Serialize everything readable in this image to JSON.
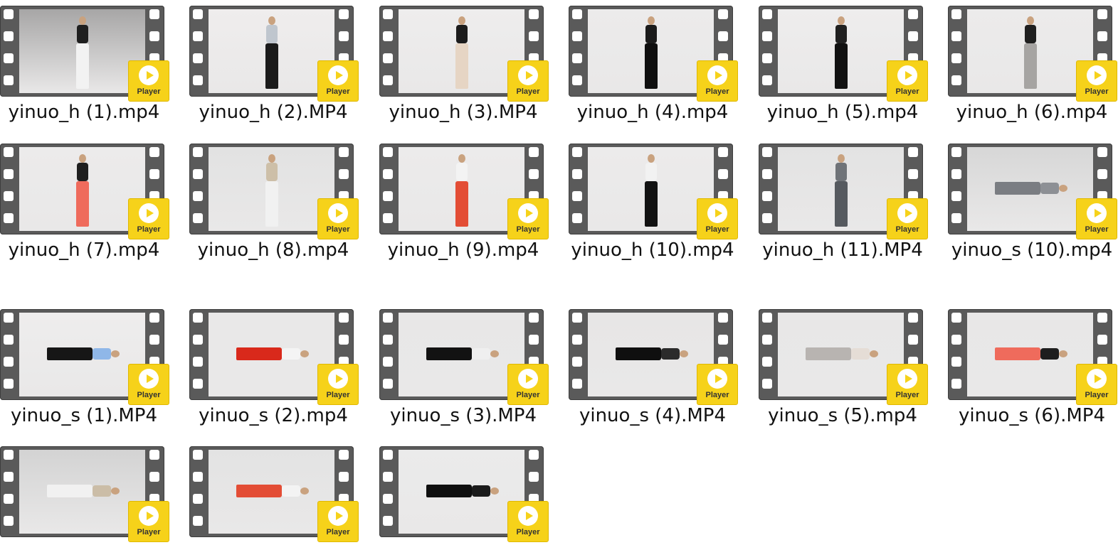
{
  "files": [
    {
      "name": "yinuo_h (1).mp4",
      "badge": "Player",
      "thumb": {
        "top": "#1f1f1f",
        "legs": "#f2f2f2",
        "bg": "#a7a6a6",
        "rot": false
      }
    },
    {
      "name": "yinuo_h (2).MP4",
      "badge": "Player",
      "thumb": {
        "top": "#bfc6ce",
        "legs": "#1b1b1b",
        "bg": "#efeded",
        "rot": false
      }
    },
    {
      "name": "yinuo_h (3).MP4",
      "badge": "Player",
      "thumb": {
        "top": "#1c1c1c",
        "legs": "#e6d5c4",
        "bg": "#eeeded",
        "rot": false
      }
    },
    {
      "name": "yinuo_h (4).mp4",
      "badge": "Player",
      "thumb": {
        "top": "#1b1b1b",
        "legs": "#0f0f0f",
        "bg": "#ecebeb",
        "rot": false
      }
    },
    {
      "name": "yinuo_h (5).mp4",
      "badge": "Player",
      "thumb": {
        "top": "#202020",
        "legs": "#111111",
        "bg": "#eeeded",
        "rot": false
      }
    },
    {
      "name": "yinuo_h (6).mp4",
      "badge": "Player",
      "thumb": {
        "top": "#1f1f1f",
        "legs": "#a6a4a2",
        "bg": "#ecebeb",
        "rot": false
      }
    },
    {
      "name": "yinuo_h (7).mp4",
      "badge": "Player",
      "thumb": {
        "top": "#1f1f1f",
        "legs": "#ef6b5c",
        "bg": "#ecebeb",
        "rot": false
      }
    },
    {
      "name": "yinuo_h (8).mp4",
      "badge": "Player",
      "thumb": {
        "top": "#cdbfa8",
        "legs": "#f1f1f1",
        "bg": "#e2e2e2",
        "rot": false
      }
    },
    {
      "name": "yinuo_h (9).mp4",
      "badge": "Player",
      "thumb": {
        "top": "#f3f3f3",
        "legs": "#e34d35",
        "bg": "#ecebeb",
        "rot": false
      }
    },
    {
      "name": "yinuo_h (10).mp4",
      "badge": "Player",
      "thumb": {
        "top": "#f2f2f2",
        "legs": "#121212",
        "bg": "#ecebeb",
        "rot": false
      }
    },
    {
      "name": "yinuo_h (11).MP4",
      "badge": "Player",
      "thumb": {
        "top": "#6f7378",
        "legs": "#565a5f",
        "bg": "#e3e3e3",
        "rot": false
      }
    },
    {
      "name": "yinuo_s (10).mp4",
      "badge": "Player",
      "thumb": {
        "top": "#8d9095",
        "legs": "#7a7d82",
        "bg": "#d7d7d7",
        "rot": true
      }
    },
    {
      "name": "yinuo_s (1).MP4",
      "badge": "Player",
      "thumb": {
        "top": "#8fb7e8",
        "legs": "#161616",
        "bg": "#eeeded",
        "rot": true
      }
    },
    {
      "name": "yinuo_s (2).mp4",
      "badge": "Player",
      "thumb": {
        "top": "#f4f4f4",
        "legs": "#d9291b",
        "bg": "#e9e8e8",
        "rot": true
      }
    },
    {
      "name": "yinuo_s (3).MP4",
      "badge": "Player",
      "thumb": {
        "top": "#efefef",
        "legs": "#121212",
        "bg": "#e8e7e7",
        "rot": true
      }
    },
    {
      "name": "yinuo_s (4).MP4",
      "badge": "Player",
      "thumb": {
        "top": "#2b2b2b",
        "legs": "#0f0f0f",
        "bg": "#e7e6e6",
        "rot": true
      }
    },
    {
      "name": "yinuo_s (5).mp4",
      "badge": "Player",
      "thumb": {
        "top": "#e5ddd6",
        "legs": "#b8b4b1",
        "bg": "#e8e7e7",
        "rot": true
      }
    },
    {
      "name": "yinuo_s (6).MP4",
      "badge": "Player",
      "thumb": {
        "top": "#1e1e1e",
        "legs": "#ef6b5c",
        "bg": "#e8e7e7",
        "rot": true
      }
    },
    {
      "name": "",
      "badge": "Player",
      "thumb": {
        "top": "#cbbda7",
        "legs": "#f1f1f1",
        "bg": "#d3d3d3",
        "rot": true
      }
    },
    {
      "name": "",
      "badge": "Player",
      "thumb": {
        "top": "#f3f3f3",
        "legs": "#e34d35",
        "bg": "#e3e3e3",
        "rot": true
      }
    },
    {
      "name": "",
      "badge": "Player",
      "thumb": {
        "top": "#1b1b1b",
        "legs": "#0f0f0f",
        "bg": "#ebebeb",
        "rot": true
      }
    }
  ]
}
